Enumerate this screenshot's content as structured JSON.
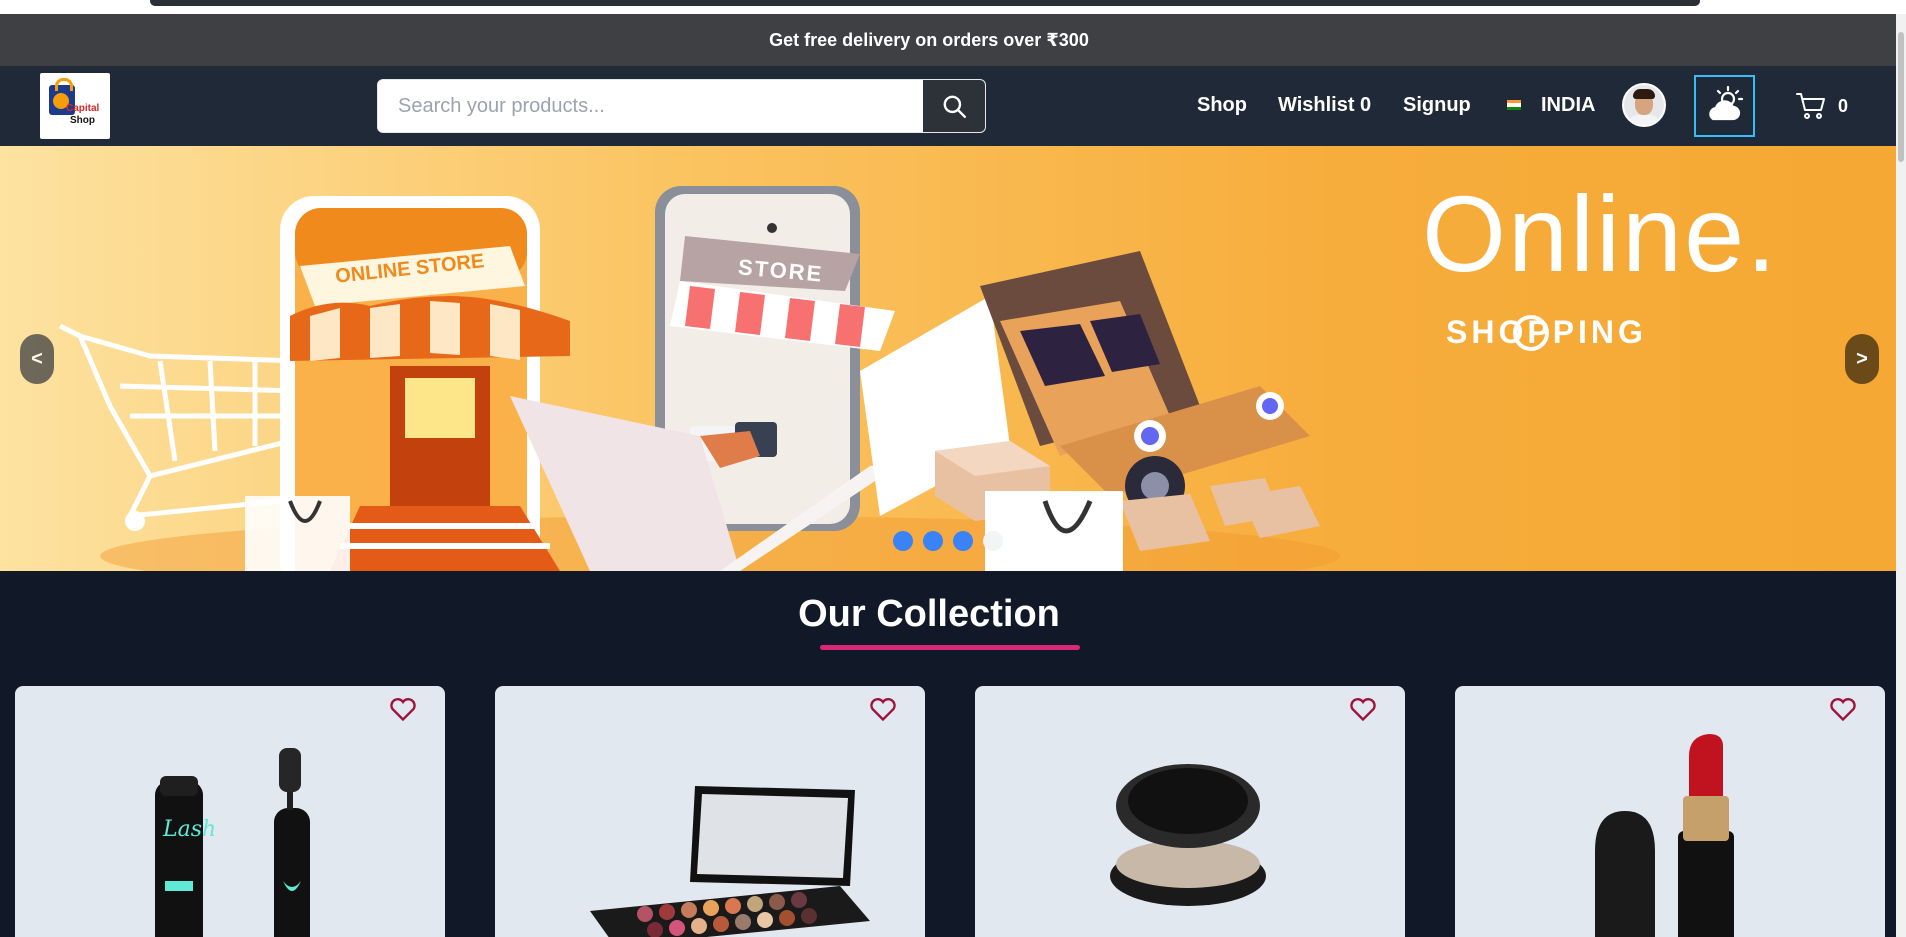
{
  "promo": {
    "text": "Get free delivery on orders over ₹300"
  },
  "logo": {
    "line1": "Capital",
    "line2": "Shop"
  },
  "search": {
    "placeholder": "Search your products...",
    "icon": "search-icon"
  },
  "nav": {
    "shop": "Shop",
    "wishlist": "Wishlist 0",
    "signup": "Signup",
    "country": "INDIA",
    "cart_count": "0"
  },
  "hero": {
    "headline": "Online.",
    "subline": "SHOPPING",
    "store_sign": "ONLINE STORE",
    "phone_sign": "STORE",
    "prev": "<",
    "next": ">",
    "slides": 4,
    "active_slide": 4
  },
  "collection": {
    "title": "Our Collection",
    "products": [
      {
        "name": "mascara",
        "icon": "heart-icon"
      },
      {
        "name": "eyeshadow-palette",
        "icon": "heart-icon"
      },
      {
        "name": "compact-powder",
        "icon": "heart-icon"
      },
      {
        "name": "lipstick",
        "icon": "heart-icon"
      }
    ]
  },
  "colors": {
    "page_bg": "#111827",
    "navbar": "#1f2937",
    "promo": "#3f4044",
    "accent_underline": "#db2777",
    "heart": "#9f1239",
    "dot_blue": "#3b82f6",
    "weather_border": "#38bdf8"
  }
}
